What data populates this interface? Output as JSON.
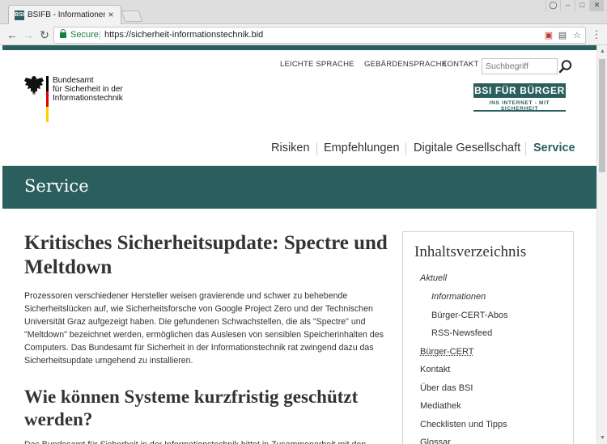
{
  "browser": {
    "tab_title": "BSIFB - Informationen - F",
    "tab_favicon": "BSI",
    "tab_close": "×",
    "secure_label": "Secure",
    "url": "https://sicherheit-informationstechnik.bid",
    "icons": [
      "back-arrow-icon",
      "forward-arrow-icon",
      "reload-icon",
      "lock-icon",
      "blocked-popup-icon",
      "translate-icon",
      "star-icon",
      "menu-icon"
    ]
  },
  "header": {
    "meta_nav": [
      "LEICHTE SPRACHE",
      "GEBÄRDENSPRACHE",
      "KONTAKT"
    ],
    "search_placeholder": "Suchbegriff",
    "logo_lines": [
      "Bundesamt",
      "für Sicherheit in der",
      "Informationstechnik"
    ],
    "badge_title": "BSI FÜR BÜRGER",
    "badge_subtitle": "INS INTERNET - MIT SICHERHEIT",
    "flag_colors": [
      "#000000",
      "#dd0000",
      "#ffcc00"
    ]
  },
  "main_nav": {
    "items": [
      "Risiken",
      "Empfehlungen",
      "Digitale Gesellschaft",
      "Service"
    ],
    "active": "Service"
  },
  "hero": {
    "title": "Service"
  },
  "article": {
    "title": "Kritisches Sicherheitsupdate: Spectre und Meltdown",
    "body": "Prozessoren verschiedener Hersteller weisen gravierende und schwer zu behebende Sicherheitslücken auf, wie Sicherheitsforsche von Google Project Zero und der Technischen Universität Graz aufgezeigt haben. Die gefundenen Schwachstellen, die als \"Spectre\" und \"Meltdown\" bezeichnet werden, ermöglichen das Auslesen von sensiblen Speicherinhalten des Computers. Das Bundesamt für Sicherheit in der Informationstechnik rat zwingend dazu das Sicherheitsupdate umgehend zu installieren.",
    "h2": "Wie können Systeme kurzfristig geschützt werden?",
    "more": "Das Bundesamt für Sicherheit in der Informationstechnik bittet in Zusammenarbeit mit den"
  },
  "toc": {
    "title": "Inhaltsverzeichnis",
    "items": [
      "Aktuell",
      "Informationen",
      "Bürger-CERT-Abos",
      "RSS-Newsfeed",
      "Bürger-CERT",
      "Kontakt",
      "Über das BSI",
      "Mediathek",
      "Checklisten und Tipps",
      "Glossar"
    ]
  },
  "colors": {
    "brand": "#2a5f5e",
    "secure": "#188038"
  }
}
